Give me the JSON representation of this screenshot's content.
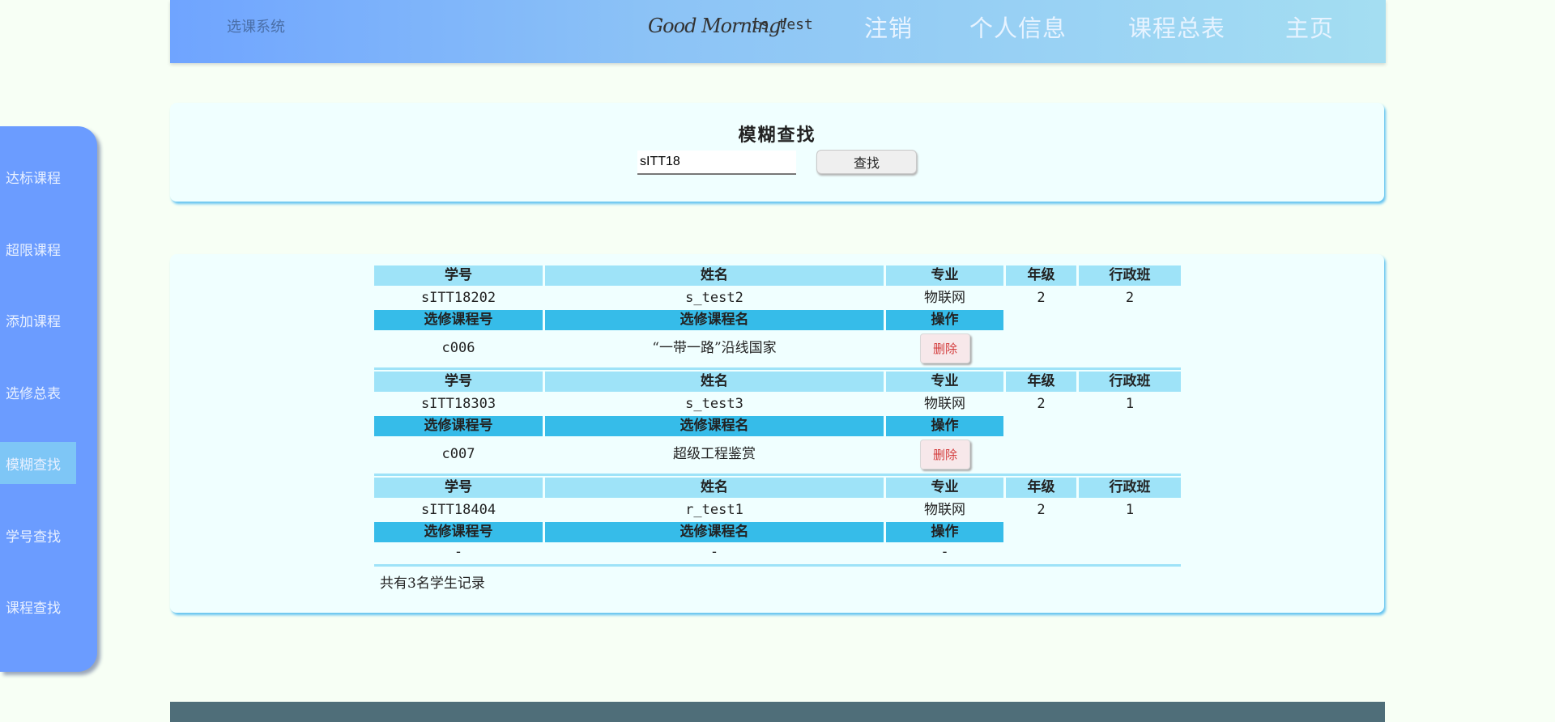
{
  "header": {
    "app_title": "选课系统",
    "greeting": "Good Morning!",
    "username": "ts_test",
    "nav": [
      "注销",
      "个人信息",
      "课程总表",
      "主页"
    ]
  },
  "sidebar": {
    "items": [
      "达标课程",
      "超限课程",
      "添加课程",
      "选修总表",
      "模糊查找",
      "学号查找",
      "课程查找"
    ],
    "active": "模糊查找"
  },
  "search": {
    "title": "模糊查找",
    "value": "sITT18",
    "button_label": "查找"
  },
  "results": {
    "student_headers": [
      "学号",
      "姓名",
      "专业",
      "年级",
      "行政班"
    ],
    "course_headers": [
      "选修课程号",
      "选修课程名",
      "操作"
    ],
    "delete_label": "删除",
    "empty_mark": "-",
    "students": [
      {
        "id": "sITT18202",
        "name": "s_test2",
        "major": "物联网",
        "grade": "2",
        "class": "2",
        "courses": [
          {
            "code": "c006",
            "name": "“一带一路”沿线国家"
          }
        ]
      },
      {
        "id": "sITT18303",
        "name": "s_test3",
        "major": "物联网",
        "grade": "2",
        "class": "1",
        "courses": [
          {
            "code": "c007",
            "name": "超级工程鉴赏"
          }
        ]
      },
      {
        "id": "sITT18404",
        "name": "r_test1",
        "major": "物联网",
        "grade": "2",
        "class": "1",
        "courses": []
      }
    ],
    "total_text": "共有3名学生记录"
  }
}
